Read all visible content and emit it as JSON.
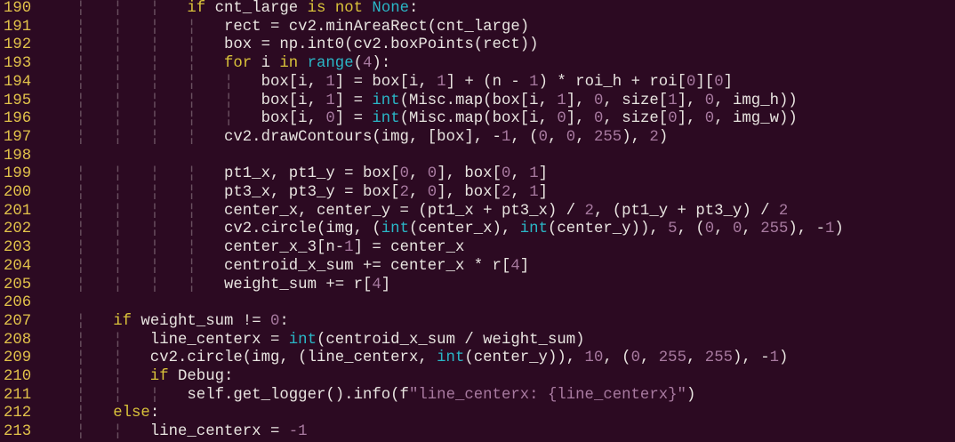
{
  "editor": {
    "colors": {
      "background": "#2c0a22",
      "text": "#e8e4e0",
      "line_number": "#e2c24a",
      "keyword": "#d9c23a",
      "builtin": "#2ab6c6",
      "number": "#a87aa0",
      "string": "#a87aa0",
      "indent_guide": "#6a5060"
    },
    "lines": [
      {
        "num": "190",
        "indent": 16,
        "tokens": [
          [
            "k",
            "if"
          ],
          [
            "t",
            " cnt_large "
          ],
          [
            "k",
            "is"
          ],
          [
            "t",
            " "
          ],
          [
            "k",
            "not"
          ],
          [
            "t",
            " "
          ],
          [
            "b",
            "None"
          ],
          [
            "t",
            ":"
          ]
        ]
      },
      {
        "num": "191",
        "indent": 20,
        "tokens": [
          [
            "t",
            "rect = cv2.minAreaRect(cnt_large)"
          ]
        ]
      },
      {
        "num": "192",
        "indent": 20,
        "tokens": [
          [
            "t",
            "box = np.int0(cv2.boxPoints(rect))"
          ]
        ]
      },
      {
        "num": "193",
        "indent": 20,
        "tokens": [
          [
            "k",
            "for"
          ],
          [
            "t",
            " i "
          ],
          [
            "k",
            "in"
          ],
          [
            "t",
            " "
          ],
          [
            "b",
            "range"
          ],
          [
            "t",
            "("
          ],
          [
            "n",
            "4"
          ],
          [
            "t",
            "):"
          ]
        ]
      },
      {
        "num": "194",
        "indent": 24,
        "tokens": [
          [
            "t",
            "box[i, "
          ],
          [
            "n",
            "1"
          ],
          [
            "t",
            "] = box[i, "
          ],
          [
            "n",
            "1"
          ],
          [
            "t",
            "] + (n - "
          ],
          [
            "n",
            "1"
          ],
          [
            "t",
            ") * roi_h + roi["
          ],
          [
            "n",
            "0"
          ],
          [
            "t",
            "]["
          ],
          [
            "n",
            "0"
          ],
          [
            "t",
            "]"
          ]
        ]
      },
      {
        "num": "195",
        "indent": 24,
        "tokens": [
          [
            "t",
            "box[i, "
          ],
          [
            "n",
            "1"
          ],
          [
            "t",
            "] = "
          ],
          [
            "b",
            "int"
          ],
          [
            "t",
            "(Misc.map(box[i, "
          ],
          [
            "n",
            "1"
          ],
          [
            "t",
            "], "
          ],
          [
            "n",
            "0"
          ],
          [
            "t",
            ", size["
          ],
          [
            "n",
            "1"
          ],
          [
            "t",
            "], "
          ],
          [
            "n",
            "0"
          ],
          [
            "t",
            ", img_h))"
          ]
        ]
      },
      {
        "num": "196",
        "indent": 24,
        "tokens": [
          [
            "t",
            "box[i, "
          ],
          [
            "n",
            "0"
          ],
          [
            "t",
            "] = "
          ],
          [
            "b",
            "int"
          ],
          [
            "t",
            "(Misc.map(box[i, "
          ],
          [
            "n",
            "0"
          ],
          [
            "t",
            "], "
          ],
          [
            "n",
            "0"
          ],
          [
            "t",
            ", size["
          ],
          [
            "n",
            "0"
          ],
          [
            "t",
            "], "
          ],
          [
            "n",
            "0"
          ],
          [
            "t",
            ", img_w))"
          ]
        ]
      },
      {
        "num": "197",
        "indent": 20,
        "tokens": [
          [
            "t",
            "cv2.drawContours(img, [box], -"
          ],
          [
            "n",
            "1"
          ],
          [
            "t",
            ", ("
          ],
          [
            "n",
            "0"
          ],
          [
            "t",
            ", "
          ],
          [
            "n",
            "0"
          ],
          [
            "t",
            ", "
          ],
          [
            "n",
            "255"
          ],
          [
            "t",
            "), "
          ],
          [
            "n",
            "2"
          ],
          [
            "t",
            ")"
          ]
        ]
      },
      {
        "num": "198",
        "indent": 0,
        "tokens": []
      },
      {
        "num": "199",
        "indent": 20,
        "tokens": [
          [
            "t",
            "pt1_x, pt1_y = box["
          ],
          [
            "n",
            "0"
          ],
          [
            "t",
            ", "
          ],
          [
            "n",
            "0"
          ],
          [
            "t",
            "], box["
          ],
          [
            "n",
            "0"
          ],
          [
            "t",
            ", "
          ],
          [
            "n",
            "1"
          ],
          [
            "t",
            "]"
          ]
        ]
      },
      {
        "num": "200",
        "indent": 20,
        "tokens": [
          [
            "t",
            "pt3_x, pt3_y = box["
          ],
          [
            "n",
            "2"
          ],
          [
            "t",
            ", "
          ],
          [
            "n",
            "0"
          ],
          [
            "t",
            "], box["
          ],
          [
            "n",
            "2"
          ],
          [
            "t",
            ", "
          ],
          [
            "n",
            "1"
          ],
          [
            "t",
            "]"
          ]
        ]
      },
      {
        "num": "201",
        "indent": 20,
        "tokens": [
          [
            "t",
            "center_x, center_y = (pt1_x + pt3_x) / "
          ],
          [
            "n",
            "2"
          ],
          [
            "t",
            ", (pt1_y + pt3_y) / "
          ],
          [
            "n",
            "2"
          ]
        ]
      },
      {
        "num": "202",
        "indent": 20,
        "tokens": [
          [
            "t",
            "cv2.circle(img, ("
          ],
          [
            "b",
            "int"
          ],
          [
            "t",
            "(center_x), "
          ],
          [
            "b",
            "int"
          ],
          [
            "t",
            "(center_y)), "
          ],
          [
            "n",
            "5"
          ],
          [
            "t",
            ", ("
          ],
          [
            "n",
            "0"
          ],
          [
            "t",
            ", "
          ],
          [
            "n",
            "0"
          ],
          [
            "t",
            ", "
          ],
          [
            "n",
            "255"
          ],
          [
            "t",
            "), -"
          ],
          [
            "n",
            "1"
          ],
          [
            "t",
            ")"
          ]
        ]
      },
      {
        "num": "203",
        "indent": 20,
        "tokens": [
          [
            "t",
            "center_x_3[n-"
          ],
          [
            "n",
            "1"
          ],
          [
            "t",
            "] = center_x"
          ]
        ]
      },
      {
        "num": "204",
        "indent": 20,
        "tokens": [
          [
            "t",
            "centroid_x_sum += center_x * r["
          ],
          [
            "n",
            "4"
          ],
          [
            "t",
            "]"
          ]
        ]
      },
      {
        "num": "205",
        "indent": 20,
        "tokens": [
          [
            "t",
            "weight_sum += r["
          ],
          [
            "n",
            "4"
          ],
          [
            "t",
            "]"
          ]
        ]
      },
      {
        "num": "206",
        "indent": 0,
        "tokens": []
      },
      {
        "num": "207",
        "indent": 8,
        "tokens": [
          [
            "k",
            "if"
          ],
          [
            "t",
            " weight_sum != "
          ],
          [
            "n",
            "0"
          ],
          [
            "t",
            ":"
          ]
        ]
      },
      {
        "num": "208",
        "indent": 12,
        "tokens": [
          [
            "t",
            "line_centerx = "
          ],
          [
            "b",
            "int"
          ],
          [
            "t",
            "(centroid_x_sum / weight_sum)"
          ]
        ]
      },
      {
        "num": "209",
        "indent": 12,
        "tokens": [
          [
            "t",
            "cv2.circle(img, (line_centerx, "
          ],
          [
            "b",
            "int"
          ],
          [
            "t",
            "(center_y)), "
          ],
          [
            "n",
            "10"
          ],
          [
            "t",
            ", ("
          ],
          [
            "n",
            "0"
          ],
          [
            "t",
            ", "
          ],
          [
            "n",
            "255"
          ],
          [
            "t",
            ", "
          ],
          [
            "n",
            "255"
          ],
          [
            "t",
            "), -"
          ],
          [
            "n",
            "1"
          ],
          [
            "t",
            ")"
          ]
        ]
      },
      {
        "num": "210",
        "indent": 12,
        "tokens": [
          [
            "k",
            "if"
          ],
          [
            "t",
            " Debug:"
          ]
        ]
      },
      {
        "num": "211",
        "indent": 16,
        "tokens": [
          [
            "t",
            "self.get_logger().info(f"
          ],
          [
            "s",
            "\"line_centerx: {line_centerx}\""
          ],
          [
            "t",
            ")"
          ]
        ]
      },
      {
        "num": "212",
        "indent": 8,
        "tokens": [
          [
            "k",
            "else"
          ],
          [
            "t",
            ":"
          ]
        ]
      },
      {
        "num": "213",
        "indent": 12,
        "tokens": [
          [
            "t",
            "line_centerx = "
          ],
          [
            "n",
            "-1"
          ]
        ]
      }
    ]
  }
}
